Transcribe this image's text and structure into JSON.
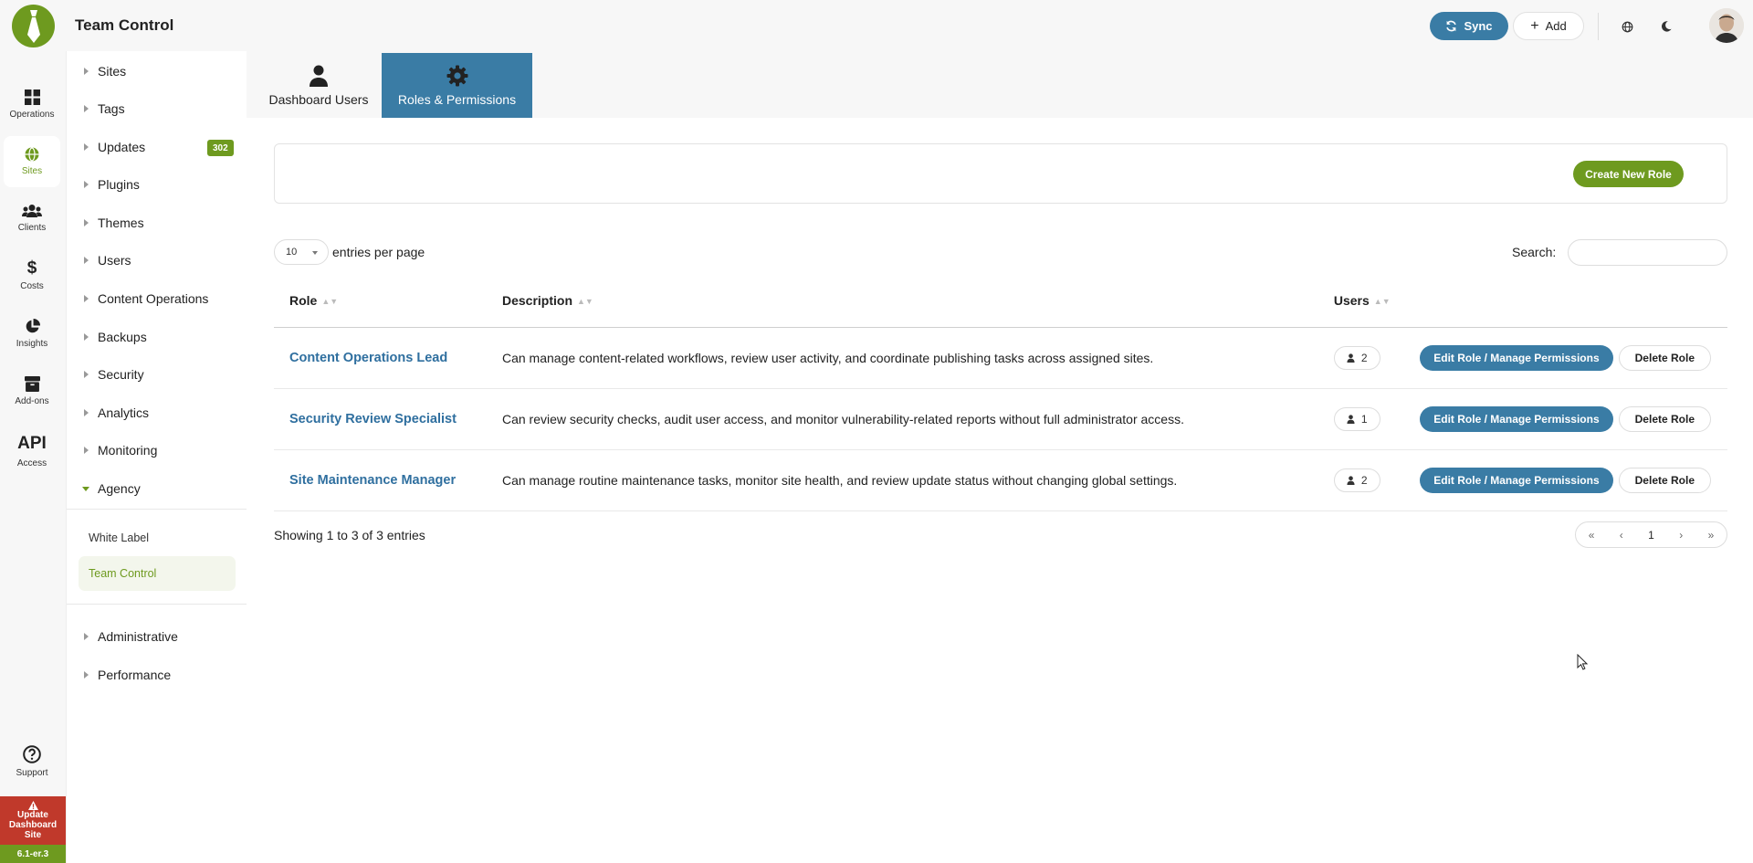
{
  "app": {
    "title": "Team Control"
  },
  "topbar": {
    "sync_label": "Sync",
    "add_label": "Add"
  },
  "rail": {
    "items": [
      {
        "label": "Operations",
        "icon": "grid-icon"
      },
      {
        "label": "Sites",
        "icon": "globe-icon",
        "active": true
      },
      {
        "label": "Clients",
        "icon": "users-icon"
      },
      {
        "label": "Costs",
        "icon": "dollar-icon"
      },
      {
        "label": "Insights",
        "icon": "pie-chart-icon"
      },
      {
        "label": "Add-ons",
        "icon": "box-icon"
      },
      {
        "label": "Access",
        "icon": "api-text",
        "icon_text": "API"
      },
      {
        "label": "Support",
        "icon": "question-icon"
      }
    ],
    "update_label": "Update Dashboard Site",
    "version": "6.1-er.3"
  },
  "sidemenu": {
    "items": [
      {
        "label": "Sites"
      },
      {
        "label": "Tags"
      },
      {
        "label": "Updates",
        "badge": "302"
      },
      {
        "label": "Plugins"
      },
      {
        "label": "Themes"
      },
      {
        "label": "Users"
      },
      {
        "label": "Content Operations"
      },
      {
        "label": "Backups"
      },
      {
        "label": "Security"
      },
      {
        "label": "Analytics"
      },
      {
        "label": "Monitoring"
      },
      {
        "label": "Agency",
        "expanded": true
      },
      {
        "label": "Administrative"
      },
      {
        "label": "Performance"
      }
    ],
    "agency_children": [
      {
        "label": "White Label"
      },
      {
        "label": "Team Control",
        "active": true
      }
    ]
  },
  "tabs": [
    {
      "label": "Dashboard Users",
      "icon": "user-icon"
    },
    {
      "label": "Roles & Permissions",
      "icon": "gear-icon",
      "active": true
    }
  ],
  "main": {
    "create_role_label": "Create New Role",
    "length_value": "10",
    "length_text": "entries per page",
    "search_label": "Search:",
    "search_value": "",
    "columns": [
      "Role",
      "Description",
      "Users"
    ],
    "rows": [
      {
        "role": "Content Operations Lead",
        "description": "Can manage content-related workflows, review user activity, and coordinate publishing tasks across assigned sites.",
        "users": "2"
      },
      {
        "role": "Security Review Specialist",
        "description": "Can review security checks, audit user access, and monitor vulnerability-related reports without full administrator access.",
        "users": "1"
      },
      {
        "role": "Site Maintenance Manager",
        "description": "Can manage routine maintenance tasks, monitor site health, and review update status without changing global settings.",
        "users": "2"
      }
    ],
    "edit_label": "Edit Role / Manage Permissions",
    "delete_label": "Delete Role",
    "info": "Showing 1 to 3 of 3 entries",
    "pager": {
      "first": "«",
      "prev": "‹",
      "current": "1",
      "next": "›",
      "last": "»"
    }
  },
  "colors": {
    "brand": "#6e9a1f",
    "primary": "#3a7ca5",
    "danger": "#c0392b"
  }
}
